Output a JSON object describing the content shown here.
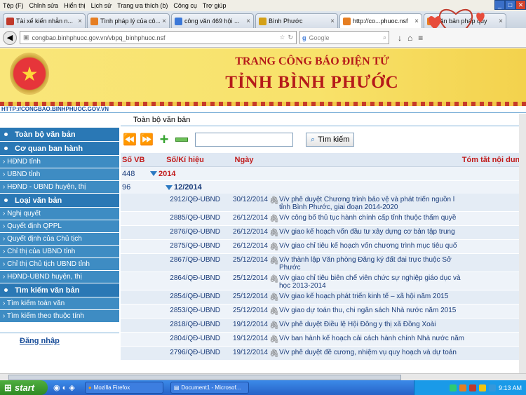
{
  "browser": {
    "menu": [
      "Tệp (F)",
      "Chỉnh sửa",
      "Hiển thị",
      "Lịch sử",
      "Trang ưa thích (b)",
      "Công cụ",
      "Trợ giúp"
    ],
    "tabs": [
      {
        "label": "Tài xế kiến nhẫn n...",
        "color": "#c0392b"
      },
      {
        "label": "Tình pháp lý của cô...",
        "color": "#e67e22"
      },
      {
        "label": "công văn 469 hội ...",
        "color": "#3b78d8"
      },
      {
        "label": "Bình Phước",
        "color": "#d4a017"
      },
      {
        "label": "http://co...phuoc.nsf",
        "color": "#e67e22"
      },
      {
        "label": "văn bản pháp quy",
        "color": "#e67e22"
      }
    ],
    "url": "congbao.binhphuoc.gov.vn/vbpq_binhphuoc.nsf",
    "search_placeholder": "Google"
  },
  "banner": {
    "title_line1": "TRANG CÔNG BÁO ĐIỆN TỬ",
    "title_line2": "TỈNH BÌNH PHƯỚC",
    "site_link": "HTTP://CONGBAO.BINHPHUOC.GOV.VN"
  },
  "sidebar": {
    "sections": [
      {
        "title": "Toàn bộ văn bản",
        "items": []
      },
      {
        "title": "Cơ quan ban hành",
        "items": [
          "› HĐND tỉnh",
          "› UBND tỉnh",
          "› HĐND - UBND huyện, thị"
        ]
      },
      {
        "title": "Loại văn bản",
        "items": [
          "› Nghị quyết",
          "› Quyết định QPPL",
          "› Quyết định của Chủ tịch",
          "› Chỉ thị của UBND tỉnh",
          "› Chỉ thị Chủ tịch UBND tỉnh",
          "› HĐND-UBND huyện, thị"
        ]
      },
      {
        "title": "Tìm kiếm văn bản",
        "items": [
          "› Tìm kiếm toàn văn",
          "› Tìm kiếm theo thuộc tính"
        ]
      }
    ],
    "login": "Đăng nhập"
  },
  "main": {
    "title": "Toàn bộ văn bản",
    "search_button": "Tìm kiếm",
    "columns": [
      "Số VB",
      "Số/Kí hiệu",
      "Ngày",
      "Tóm tắt nội dung"
    ],
    "year_row": {
      "count": "448",
      "year": "2014"
    },
    "month_row": {
      "count": "96",
      "month": "12/2014"
    },
    "rows": [
      {
        "num": "2912/QĐ-UBND",
        "date": "30/12/2014",
        "summary": "V/v phê duyệt Chương trình bảo vệ và phát triển nguồn l",
        "summary2": "tỉnh Bình Phước, giai đoạn 2014-2020"
      },
      {
        "num": "2885/QĐ-UBND",
        "date": "26/12/2014",
        "summary": "V/v công bố thủ tục hành chính cấp tỉnh thuộc thẩm quyề",
        "summary2": ""
      },
      {
        "num": "2876/QĐ-UBND",
        "date": "26/12/2014",
        "summary": "V/v giao kế hoạch vốn đầu tư xây dựng cơ bản tập trung",
        "summary2": ""
      },
      {
        "num": "2875/QĐ-UBND",
        "date": "26/12/2014",
        "summary": "V/v giao chỉ tiêu kế hoạch vốn chương trình mục tiêu quố",
        "summary2": ""
      },
      {
        "num": "2867/QĐ-UBND",
        "date": "25/12/2014",
        "summary": "V/v thành lập Văn phòng Đăng ký đất đai trực thuộc Sở",
        "summary2": "Phước"
      },
      {
        "num": "2864/QĐ-UBND",
        "date": "25/12/2014",
        "summary": "V/v giao chỉ tiêu biên chế viên chức sự nghiệp giáo dục và",
        "summary2": "học 2013-2014"
      },
      {
        "num": "2854/QĐ-UBND",
        "date": "25/12/2014",
        "summary": "V/v giao kế hoạch phát triển kinh tế – xã hội năm 2015",
        "summary2": ""
      },
      {
        "num": "2853/QĐ-UBND",
        "date": "25/12/2014",
        "summary": "V/v giao dự toán thu, chi ngân sách Nhà nước năm 2015",
        "summary2": ""
      },
      {
        "num": "2818/QĐ-UBND",
        "date": "19/12/2014",
        "summary": "V/v phê duyệt Điều lệ Hội Đông y thị xã Đồng Xoài",
        "summary2": ""
      },
      {
        "num": "2804/QĐ-UBND",
        "date": "19/12/2014",
        "summary": "V/v ban hành kế hoạch cải cách hành chính Nhà nước năm",
        "summary2": ""
      },
      {
        "num": "2796/QĐ-UBND",
        "date": "19/12/2014",
        "summary": "V/v phê duyệt đề cương, nhiệm vụ quy hoạch và dự toán",
        "summary2": ""
      }
    ]
  },
  "taskbar": {
    "start": "start",
    "windows": [
      "Mozilla Firefox",
      "Document1 - Microsof..."
    ],
    "clock": "9:13 AM"
  }
}
